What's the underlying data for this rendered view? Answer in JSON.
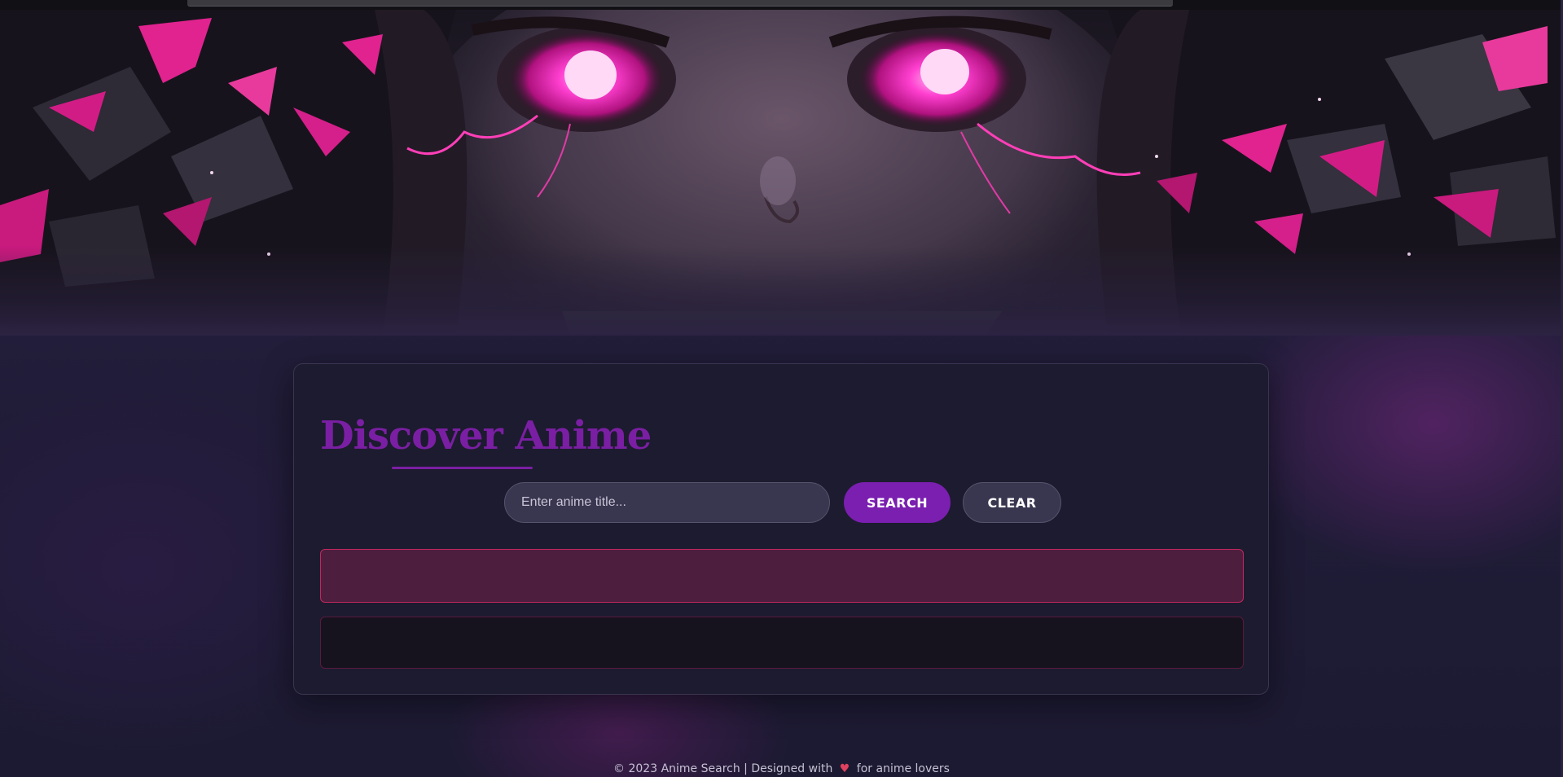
{
  "hero": {
    "image_icon": "anime-girl-glowing-eyes-banner"
  },
  "main": {
    "title": "Discover Anime",
    "search": {
      "placeholder": "Enter anime title...",
      "value": ""
    },
    "search_button_label": "SEARCH",
    "clear_button_label": "CLEAR",
    "error_message": "",
    "results_text": ""
  },
  "footer": {
    "text_before": "© 2023 Anime Search | Designed with",
    "heart_icon": "heart-icon",
    "heart_glyph": "♥",
    "text_after": "for anime lovers"
  },
  "colors": {
    "accent": "#7a1fa3",
    "button_primary": "#7a1fb0",
    "error_border": "#c2285f",
    "error_bg": "#4e1e3f",
    "glow_pink": "#ff3fb8"
  }
}
